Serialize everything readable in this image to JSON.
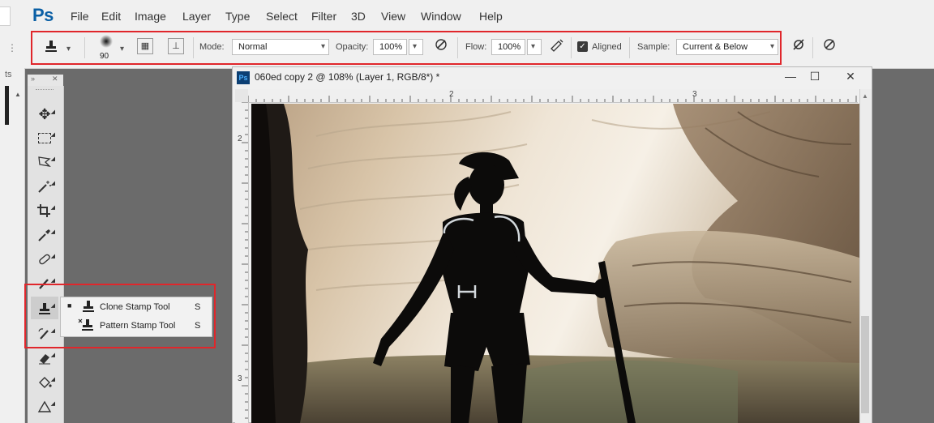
{
  "app": {
    "logo": "Ps"
  },
  "menu": [
    "File",
    "Edit",
    "Image",
    "Layer",
    "Type",
    "Select",
    "Filter",
    "3D",
    "View",
    "Window",
    "Help"
  ],
  "options": {
    "brush_size": "90",
    "mode_label": "Mode:",
    "mode_value": "Normal",
    "opacity_label": "Opacity:",
    "opacity_value": "100%",
    "flow_label": "Flow:",
    "flow_value": "100%",
    "aligned_label": "Aligned",
    "aligned_checked": true,
    "sample_label": "Sample:",
    "sample_value": "Current & Below"
  },
  "leftcol": {
    "text": "ts"
  },
  "document": {
    "title": "060ed copy 2 @ 108% (Layer 1, RGB/8*) *",
    "ruler_top": [
      "2",
      "3"
    ],
    "ruler_left": [
      "2",
      "3"
    ]
  },
  "tools": {
    "items": [
      "move-tool-icon",
      "marquee-tool-icon",
      "lasso-tool-icon",
      "magic-wand-icon",
      "crop-tool-icon",
      "eyedropper-icon",
      "healing-brush-icon",
      "brush-tool-icon",
      "clone-stamp-icon",
      "history-brush-icon",
      "eraser-icon",
      "paint-bucket-icon",
      "triangle-icon"
    ]
  },
  "flyout": {
    "items": [
      {
        "label": "Clone Stamp Tool",
        "shortcut": "S",
        "selected": true
      },
      {
        "label": "Pattern Stamp Tool",
        "shortcut": "S",
        "selected": false
      }
    ]
  },
  "colors": {
    "highlight": "#e0262b",
    "ps_blue": "#0a5fa5"
  }
}
